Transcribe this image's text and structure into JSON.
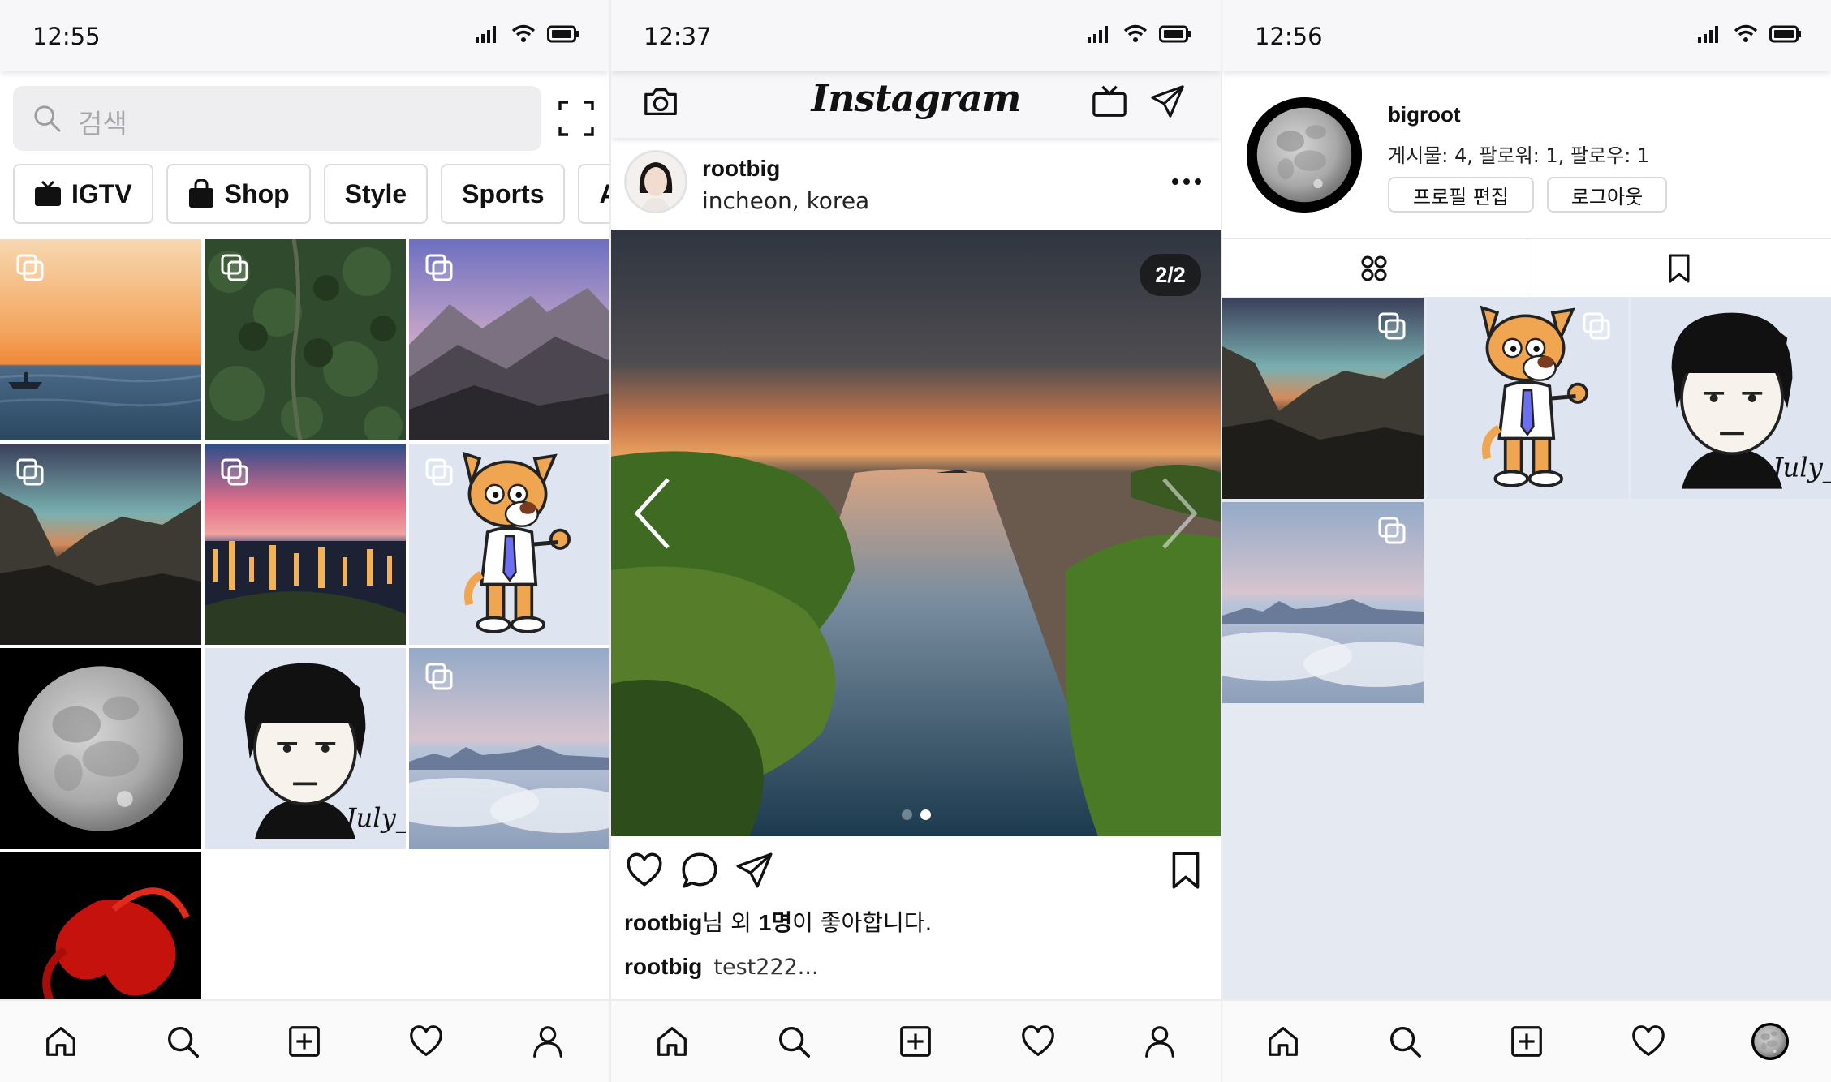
{
  "explore": {
    "status_time": "12:55",
    "search_placeholder": "검색",
    "chips": [
      "IGTV",
      "Shop",
      "Style",
      "Sports",
      "A"
    ]
  },
  "feed": {
    "status_time": "12:37",
    "logo": "Instagram",
    "post": {
      "username": "rootbig",
      "location": "incheon, korea",
      "counter": "2/2",
      "likes_user": "rootbig",
      "likes_mid": "님 외 ",
      "likes_count": "1명",
      "likes_tail": "이 좋아합니다.",
      "caption_user": "rootbig",
      "caption_text": "test222..."
    }
  },
  "profile": {
    "status_time": "12:56",
    "username": "bigroot",
    "stats": "게시물: 4, 팔로워: 1, 팔로우: 1",
    "edit_button": "프로필 편집",
    "logout_button": "로그아웃"
  },
  "icons": {
    "nav": [
      "home-icon",
      "search-icon",
      "add-post-icon",
      "heart-icon",
      "profile-icon"
    ]
  },
  "colors": {
    "panel_bg": "#ffffff",
    "profile_bg": "#e4e9f2",
    "chip_border": "#dcdcdf",
    "search_bg": "#eeeef1"
  }
}
